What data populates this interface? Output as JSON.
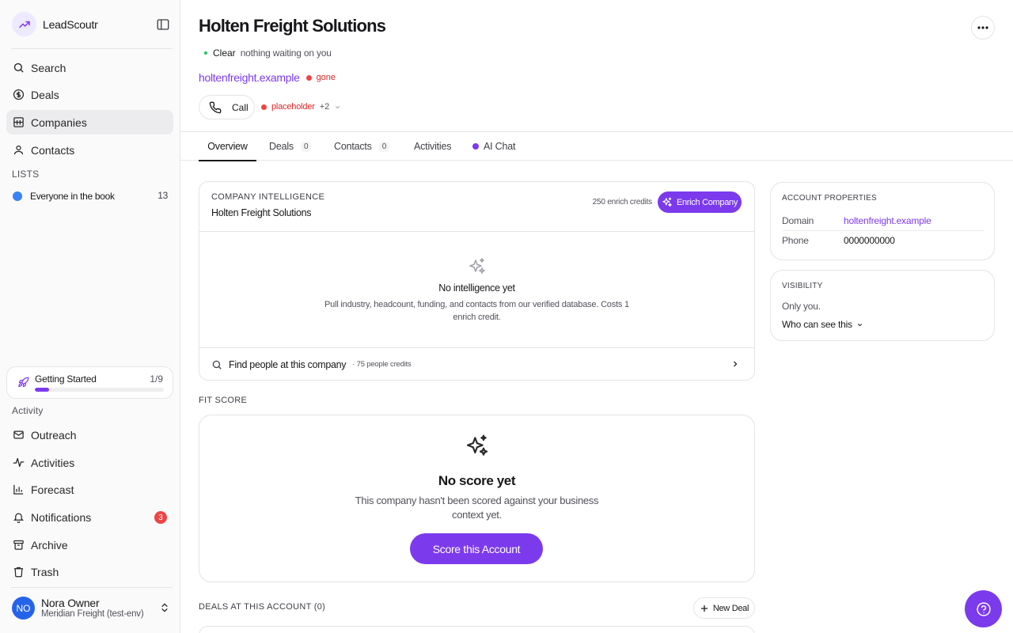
{
  "app": {
    "name": "LeadScoutr"
  },
  "sidebar": {
    "nav": [
      {
        "label": "Search",
        "icon": "search-icon"
      },
      {
        "label": "Deals",
        "icon": "dollar-circle-icon"
      },
      {
        "label": "Companies",
        "icon": "building-icon",
        "active": true
      },
      {
        "label": "Contacts",
        "icon": "user-icon"
      }
    ],
    "lists_label": "LISTS",
    "lists": [
      {
        "label": "Everyone in the book",
        "count": "13",
        "color": "#3b82f6"
      }
    ],
    "getting_started": {
      "label": "Getting Started",
      "progress_text": "1/9",
      "progress": 0.11
    },
    "activity_label": "Activity",
    "activity": [
      {
        "label": "Outreach",
        "icon": "mail-icon"
      },
      {
        "label": "Activities",
        "icon": "pulse-icon"
      },
      {
        "label": "Forecast",
        "icon": "bar-chart-icon"
      },
      {
        "label": "Notifications",
        "icon": "bell-icon",
        "badge": "3"
      },
      {
        "label": "Archive",
        "icon": "archive-icon"
      },
      {
        "label": "Trash",
        "icon": "trash-icon"
      }
    ],
    "user": {
      "initials": "NO",
      "name": "Nora Owner",
      "org": "Meridian Freight (test-env)"
    }
  },
  "company": {
    "name": "Holten Freight Solutions",
    "status": {
      "label": "Clear",
      "sub": "nothing waiting on you",
      "color": "#22c55e"
    },
    "domain": "holtenfreight.example",
    "domain_status": "gone",
    "call_label": "Call",
    "phone_status": "placeholder",
    "phone_more": "+2"
  },
  "tabs": [
    {
      "label": "Overview",
      "active": true
    },
    {
      "label": "Deals",
      "count": "0"
    },
    {
      "label": "Contacts",
      "count": "0"
    },
    {
      "label": "Activities"
    },
    {
      "label": "AI Chat"
    }
  ],
  "intelligence": {
    "eyebrow": "COMPANY INTELLIGENCE",
    "name": "Holten Freight Solutions",
    "credits": "250 enrich credits",
    "enrich_label": "Enrich Company",
    "empty_title": "No intelligence yet",
    "empty_desc": "Pull industry, headcount, funding, and contacts from our verified database. Costs 1 enrich credit.",
    "find_label": "Find people at this company",
    "find_credits": "· 75 people credits"
  },
  "fit": {
    "label": "FIT SCORE",
    "title": "No score yet",
    "desc": "This company hasn't been scored against your business context yet.",
    "button": "Score this Account"
  },
  "deals": {
    "label": "DEALS AT THIS ACCOUNT (0)",
    "new_label": "New Deal"
  },
  "properties": {
    "eyebrow": "ACCOUNT PROPERTIES",
    "domain_key": "Domain",
    "domain_value": "holtenfreight.example",
    "phone_key": "Phone",
    "phone_value": "0000000000"
  },
  "visibility": {
    "eyebrow": "VISIBILITY",
    "text": "Only you.",
    "who_label": "Who can see this"
  },
  "colors": {
    "accent": "#7c3aed",
    "danger": "#ef4444",
    "success": "#22c55e",
    "list": "#3b82f6",
    "avatar": "#2563eb"
  }
}
